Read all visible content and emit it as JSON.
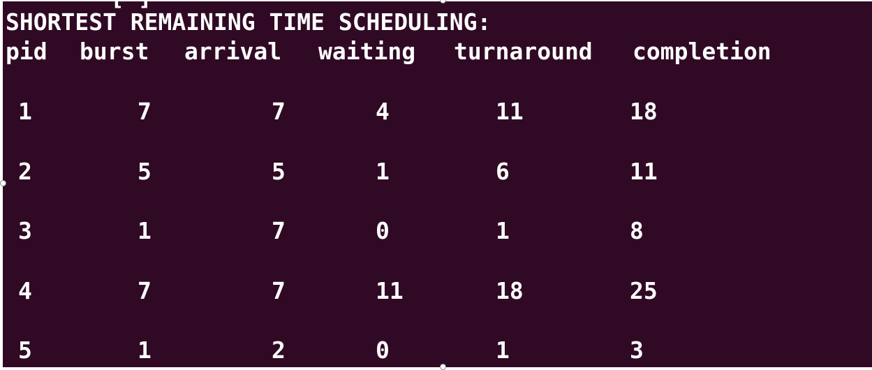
{
  "terminal": {
    "cut_off_line": "[ ]",
    "title": "SHORTEST REMAINING TIME SCHEDULING:",
    "columns": [
      "pid",
      "burst",
      "arrival",
      "waiting",
      "turnaround",
      "completion"
    ],
    "rows": [
      {
        "pid": "1",
        "burst": "7",
        "arrival": "7",
        "waiting": "4",
        "turnaround": "11",
        "completion": "18"
      },
      {
        "pid": "2",
        "burst": "5",
        "arrival": "5",
        "waiting": "1",
        "turnaround": "6",
        "completion": "11"
      },
      {
        "pid": "3",
        "burst": "1",
        "arrival": "7",
        "waiting": "0",
        "turnaround": "1",
        "completion": "8"
      },
      {
        "pid": "4",
        "burst": "7",
        "arrival": "7",
        "waiting": "11",
        "turnaround": "18",
        "completion": "25"
      },
      {
        "pid": "5",
        "burst": "1",
        "arrival": "2",
        "waiting": "0",
        "turnaround": "1",
        "completion": "3"
      }
    ],
    "colors": {
      "background": "#300a24",
      "text": "#ffffff"
    }
  }
}
